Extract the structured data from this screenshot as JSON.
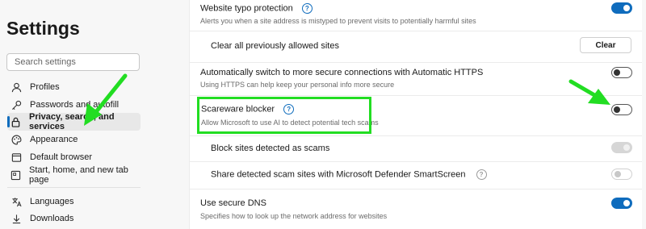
{
  "sidebar": {
    "title": "Settings",
    "search_placeholder": "Search settings",
    "items": [
      {
        "label": "Profiles"
      },
      {
        "label": "Passwords and autofill"
      },
      {
        "label": "Privacy, search, and services"
      },
      {
        "label": "Appearance"
      },
      {
        "label": "Default browser"
      },
      {
        "label": "Start, home, and new tab page"
      },
      {
        "label": "Languages"
      },
      {
        "label": "Downloads"
      }
    ]
  },
  "settings": {
    "typo": {
      "title": "Website typo protection",
      "desc": "Alerts you when a site address is mistyped to prevent visits to potentially harmful sites",
      "state": "on"
    },
    "clear_allowed": {
      "title": "Clear all previously allowed sites",
      "button": "Clear"
    },
    "https": {
      "title": "Automatically switch to more secure connections with Automatic HTTPS",
      "desc": "Using HTTPS can help keep your personal info more secure",
      "state": "off"
    },
    "scareware": {
      "title": "Scareware blocker",
      "desc": "Allow Microsoft to use AI to detect potential tech scams",
      "state": "off"
    },
    "block_scams": {
      "title": "Block sites detected as scams",
      "state": "disabled-on"
    },
    "share_scams": {
      "title": "Share detected scam sites with Microsoft Defender SmartScreen",
      "state": "disabled-off"
    },
    "secure_dns": {
      "title": "Use secure DNS",
      "desc": "Specifies how to look up the network address for websites",
      "state": "on"
    }
  },
  "colors": {
    "accent": "#0f6cbd",
    "highlight": "#22dd22",
    "annotation_arrow": "#22dd22"
  }
}
